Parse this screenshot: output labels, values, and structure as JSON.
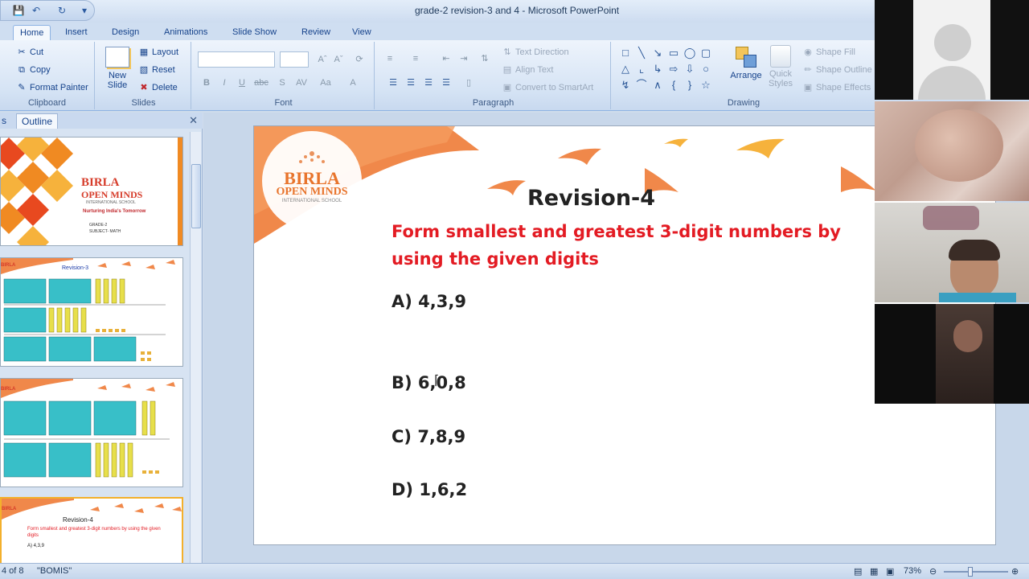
{
  "window": {
    "title": "grade-2 revision-3 and 4 - Microsoft PowerPoint"
  },
  "tabs": [
    "Home",
    "Insert",
    "Design",
    "Animations",
    "Slide Show",
    "Review",
    "View"
  ],
  "ribbon": {
    "clipboard": {
      "label": "Clipboard",
      "cut": "Cut",
      "copy": "Copy",
      "format_painter": "Format Painter"
    },
    "slides": {
      "label": "Slides",
      "new_slide": "New Slide",
      "layout": "Layout",
      "reset": "Reset",
      "delete": "Delete"
    },
    "font": {
      "label": "Font"
    },
    "paragraph": {
      "label": "Paragraph",
      "text_direction": "Text Direction",
      "align_text": "Align Text",
      "convert_smartart": "Convert to SmartArt"
    },
    "drawing": {
      "label": "Drawing",
      "arrange": "Arrange",
      "quick_styles": "Quick Styles",
      "shape_fill": "Shape Fill",
      "shape_outline": "Shape Outline",
      "shape_effects": "Shape Effects"
    }
  },
  "panel": {
    "tab_slides": "s",
    "tab_outline": "Outline",
    "thumb1": {
      "brand_line1": "BIRLA",
      "brand_line2": "OPEN MINDS",
      "brand_line3": "INTERNATIONAL SCHOOL",
      "tagline": "Nurturing India's Tomorrow",
      "grade": "GRADE-2",
      "subject": "SUBJECT- MATH"
    },
    "thumb2": {
      "brand": "BIRLA",
      "title": "Revision-3"
    },
    "thumb3": {
      "brand": "BIRLA"
    },
    "thumb4": {
      "brand": "BIRLA",
      "title": "Revision-4",
      "subtitle": "Form smallest and greatest 3-digit numbers by using the given digits",
      "first": "A) 4,3,9"
    }
  },
  "slide": {
    "logo_line1": "BIRLA",
    "logo_line2": "OPEN MINDS",
    "logo_line3": "INTERNATIONAL SCHOOL",
    "title": "Revision-4",
    "subtitle": "Form smallest and greatest 3-digit numbers by  using the given digits",
    "questions": [
      "A) 4,3,9",
      "B) 6,0,8",
      "C) 7,8,9",
      "D) 1,6,2"
    ]
  },
  "statusbar": {
    "slide_count": "4 of 8",
    "theme": "\"BOMIS\"",
    "zoom": "73%"
  },
  "colors": {
    "accent_orange": "#f0884a",
    "title_red": "#e31b23"
  }
}
